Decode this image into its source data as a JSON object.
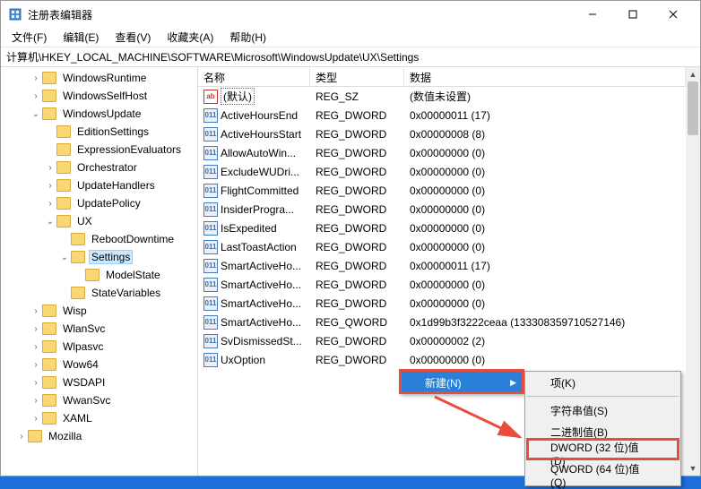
{
  "window": {
    "title": "注册表编辑器"
  },
  "menubar": {
    "file": "文件(F)",
    "edit": "编辑(E)",
    "view": "查看(V)",
    "favorites": "收藏夹(A)",
    "help": "帮助(H)"
  },
  "addressbar": {
    "path": "计算机\\HKEY_LOCAL_MACHINE\\SOFTWARE\\Microsoft\\WindowsUpdate\\UX\\Settings"
  },
  "tree": [
    {
      "label": "WindowsRuntime",
      "indent": 2,
      "toggle": ">"
    },
    {
      "label": "WindowsSelfHost",
      "indent": 2,
      "toggle": ">"
    },
    {
      "label": "WindowsUpdate",
      "indent": 2,
      "toggle": "v"
    },
    {
      "label": "EditionSettings",
      "indent": 3,
      "toggle": ""
    },
    {
      "label": "ExpressionEvaluators",
      "indent": 3,
      "toggle": ""
    },
    {
      "label": "Orchestrator",
      "indent": 3,
      "toggle": ">"
    },
    {
      "label": "UpdateHandlers",
      "indent": 3,
      "toggle": ">"
    },
    {
      "label": "UpdatePolicy",
      "indent": 3,
      "toggle": ">"
    },
    {
      "label": "UX",
      "indent": 3,
      "toggle": "v"
    },
    {
      "label": "RebootDowntime",
      "indent": 4,
      "toggle": ""
    },
    {
      "label": "Settings",
      "indent": 4,
      "toggle": "v",
      "selected": true
    },
    {
      "label": "ModelState",
      "indent": 5,
      "toggle": ""
    },
    {
      "label": "StateVariables",
      "indent": 4,
      "toggle": ""
    },
    {
      "label": "Wisp",
      "indent": 2,
      "toggle": ">"
    },
    {
      "label": "WlanSvc",
      "indent": 2,
      "toggle": ">"
    },
    {
      "label": "Wlpasvc",
      "indent": 2,
      "toggle": ">"
    },
    {
      "label": "Wow64",
      "indent": 2,
      "toggle": ">"
    },
    {
      "label": "WSDAPI",
      "indent": 2,
      "toggle": ">"
    },
    {
      "label": "WwanSvc",
      "indent": 2,
      "toggle": ">"
    },
    {
      "label": "XAML",
      "indent": 2,
      "toggle": ">"
    },
    {
      "label": "Mozilla",
      "indent": 1,
      "toggle": ">"
    }
  ],
  "list_header": {
    "name": "名称",
    "type": "类型",
    "data": "数据"
  },
  "list_rows": [
    {
      "icon": "sz",
      "name": "(默认)",
      "type": "REG_SZ",
      "data": "(数值未设置)",
      "dotted": true
    },
    {
      "icon": "bin",
      "name": "ActiveHoursEnd",
      "type": "REG_DWORD",
      "data": "0x00000011 (17)"
    },
    {
      "icon": "bin",
      "name": "ActiveHoursStart",
      "type": "REG_DWORD",
      "data": "0x00000008 (8)"
    },
    {
      "icon": "bin",
      "name": "AllowAutoWin...",
      "type": "REG_DWORD",
      "data": "0x00000000 (0)"
    },
    {
      "icon": "bin",
      "name": "ExcludeWUDri...",
      "type": "REG_DWORD",
      "data": "0x00000000 (0)"
    },
    {
      "icon": "bin",
      "name": "FlightCommitted",
      "type": "REG_DWORD",
      "data": "0x00000000 (0)"
    },
    {
      "icon": "bin",
      "name": "InsiderProgra...",
      "type": "REG_DWORD",
      "data": "0x00000000 (0)"
    },
    {
      "icon": "bin",
      "name": "IsExpedited",
      "type": "REG_DWORD",
      "data": "0x00000000 (0)"
    },
    {
      "icon": "bin",
      "name": "LastToastAction",
      "type": "REG_DWORD",
      "data": "0x00000000 (0)"
    },
    {
      "icon": "bin",
      "name": "SmartActiveHo...",
      "type": "REG_DWORD",
      "data": "0x00000011 (17)"
    },
    {
      "icon": "bin",
      "name": "SmartActiveHo...",
      "type": "REG_DWORD",
      "data": "0x00000000 (0)"
    },
    {
      "icon": "bin",
      "name": "SmartActiveHo...",
      "type": "REG_DWORD",
      "data": "0x00000000 (0)"
    },
    {
      "icon": "bin",
      "name": "SmartActiveHo...",
      "type": "REG_QWORD",
      "data": "0x1d99b3f3222ceaa (133308359710527146)"
    },
    {
      "icon": "bin",
      "name": "SvDismissedSt...",
      "type": "REG_DWORD",
      "data": "0x00000002 (2)"
    },
    {
      "icon": "bin",
      "name": "UxOption",
      "type": "REG_DWORD",
      "data": "0x00000000 (0)"
    }
  ],
  "context_menu": {
    "new": "新建(N)"
  },
  "submenu": {
    "key": "项(K)",
    "string": "字符串值(S)",
    "binary": "二进制值(B)",
    "dword": "DWORD (32 位)值(D)",
    "qword": "QWORD (64 位)值(Q)"
  }
}
